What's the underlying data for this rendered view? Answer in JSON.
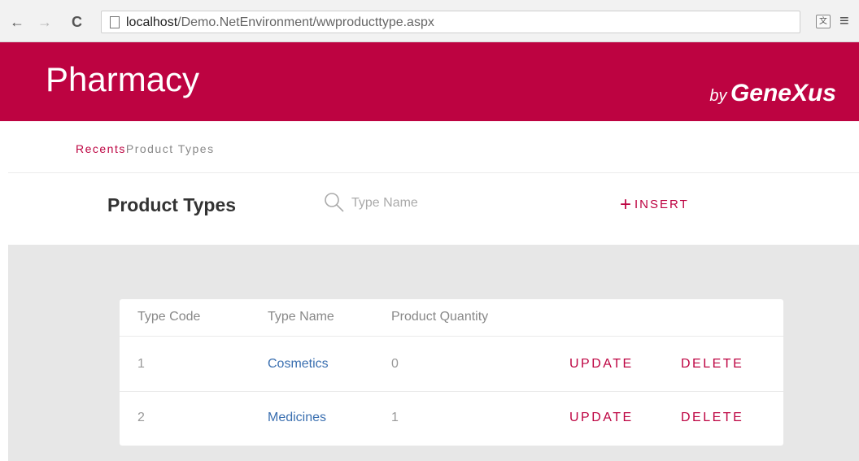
{
  "browser": {
    "url_host": "localhost",
    "url_path": "/Demo.NetEnvironment/wwproducttype.aspx",
    "back_icon": "←",
    "forward_icon": "→",
    "reload_icon": "C",
    "menu_icon": "≡"
  },
  "header": {
    "title": "Pharmacy",
    "brand_by": "by",
    "brand_name": "GeneXus",
    "color": "#bd0341"
  },
  "breadcrumb": {
    "recents": "Recents",
    "current": "Product Types"
  },
  "toolbar": {
    "page_title": "Product Types",
    "search_placeholder": "Type Name",
    "insert_plus": "+",
    "insert_label": "INSERT"
  },
  "grid": {
    "columns": [
      "Type Code",
      "Type Name",
      "Product Quantity"
    ],
    "rows": [
      {
        "code": "1",
        "name": "Cosmetics",
        "quantity": "0",
        "update": "UPDATE",
        "delete": "DELETE"
      },
      {
        "code": "2",
        "name": "Medicines",
        "quantity": "1",
        "update": "UPDATE",
        "delete": "DELETE"
      }
    ]
  }
}
